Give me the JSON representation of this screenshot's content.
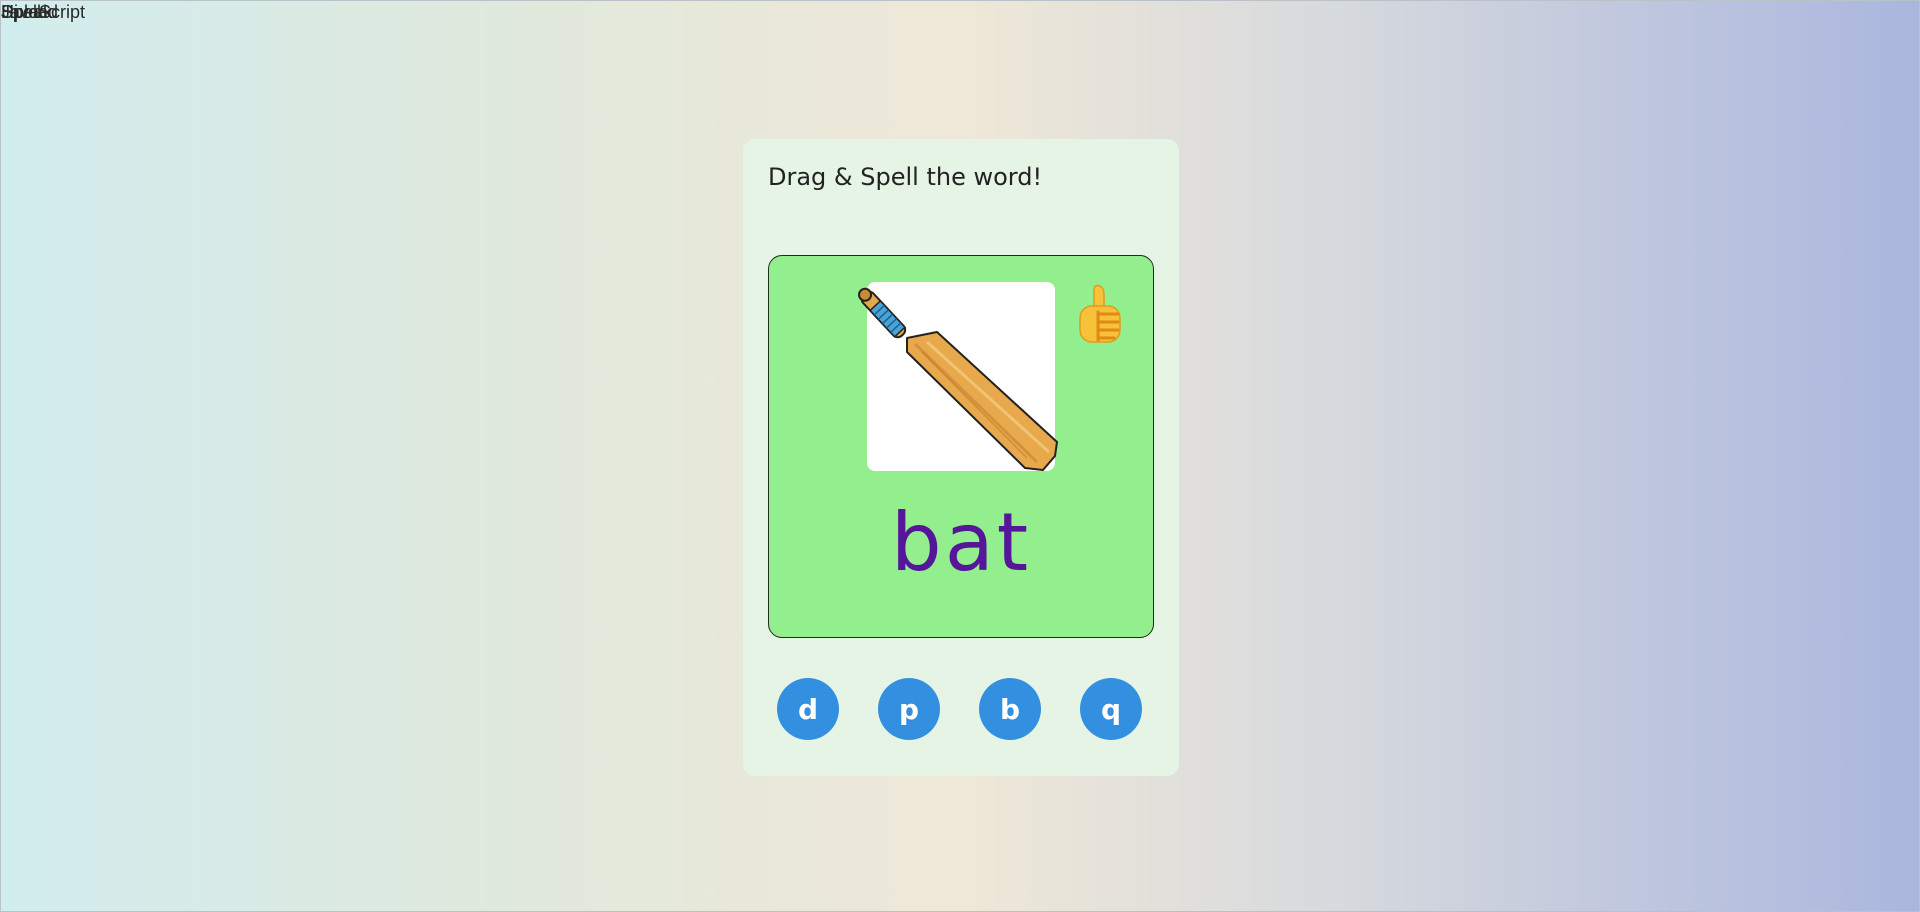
{
  "top_labels": [
    "JavaScript",
    "Upload",
    "Speak",
    "Spell",
    "Hi"
  ],
  "game": {
    "instruction": "Drag & Spell the word!",
    "picture": "cricket-bat-image",
    "feedback_icon": "thumbs-up-icon",
    "word": "bat",
    "letters": [
      "d",
      "p",
      "b",
      "q"
    ]
  },
  "colors": {
    "card_background": "#e6f4e6",
    "play_area": "#93ee8d",
    "word": "#55169a",
    "letter_button": "#3390e0"
  }
}
